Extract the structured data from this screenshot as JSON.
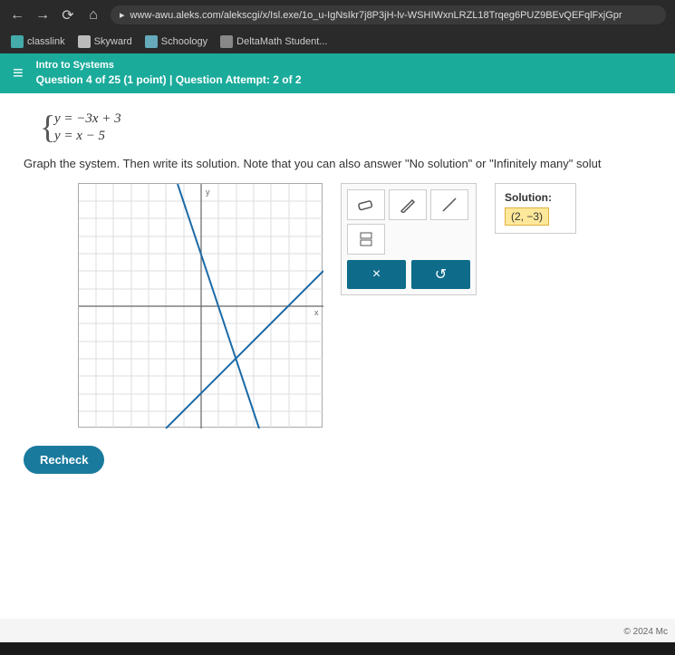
{
  "browser": {
    "url": "www-awu.aleks.com/alekscgi/x/Isl.exe/1o_u-IgNsIkr7j8P3jH-lv-WSHIWxnLRZL18Trqeg6PUZ9BEvQEFqlFxjGpr",
    "bookmarks": [
      {
        "label": "classlink"
      },
      {
        "label": "Skyward"
      },
      {
        "label": "Schoology"
      },
      {
        "label": "DeltaMath Student..."
      }
    ]
  },
  "header": {
    "topic": "Intro to Systems",
    "question_line": "Question 4 of 25 (1 point)  |  Question Attempt: 2 of 2"
  },
  "problem": {
    "eq1": "y = −3x + 3",
    "eq2": "y = x − 5",
    "instruction": "Graph the system. Then write its solution. Note that you can also answer \"No solution\" or \"Infinitely many\" solut"
  },
  "chart_data": {
    "type": "line",
    "xlim": [
      -7,
      7
    ],
    "ylim": [
      -7,
      7
    ],
    "grid": true,
    "series": [
      {
        "name": "y = -3x + 3",
        "points": [
          [
            -1.33,
            7
          ],
          [
            3.33,
            -7
          ]
        ]
      },
      {
        "name": "y = x - 5",
        "points": [
          [
            -2,
            -7
          ],
          [
            7,
            2
          ]
        ]
      }
    ],
    "intersection": [
      2,
      -3
    ]
  },
  "tools": {
    "clear_label": "×",
    "reset_label": "↺"
  },
  "solution": {
    "label": "Solution:",
    "value": "(2, −3)"
  },
  "recheck": "Recheck",
  "copyright": "© 2024 Mc"
}
